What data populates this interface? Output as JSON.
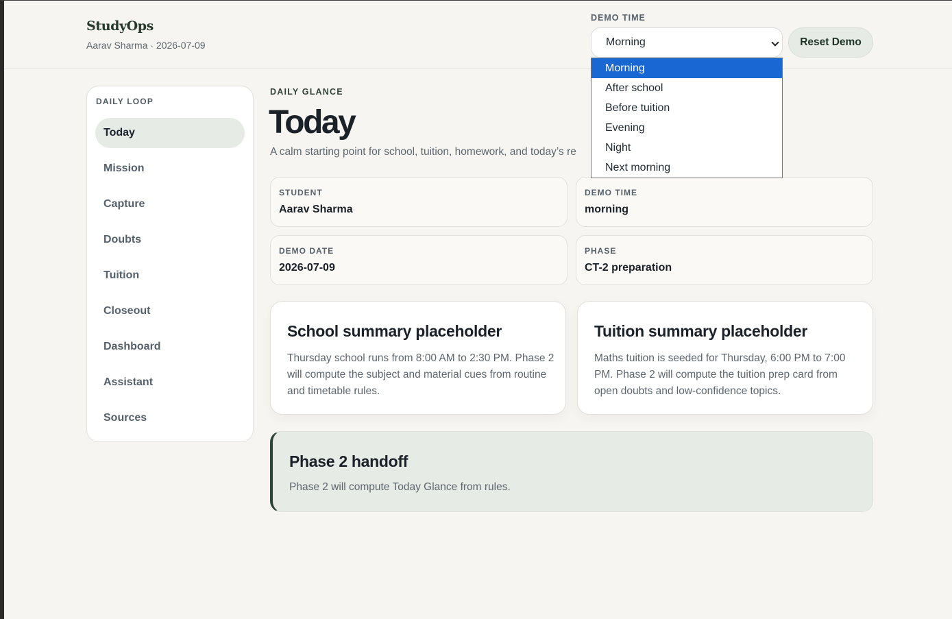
{
  "header": {
    "brand": "StudyOps",
    "subtitle": "Aarav Sharma · 2026-07-09",
    "demo_time_label": "DEMO TIME",
    "selected_time": "Morning",
    "reset_label": "Reset Demo"
  },
  "dropdown": {
    "options": [
      "Morning",
      "After school",
      "Before tuition",
      "Evening",
      "Night",
      "Next morning"
    ],
    "highlighted": "Morning"
  },
  "sidebar": {
    "heading": "DAILY LOOP",
    "items": [
      {
        "label": "Today",
        "active": true
      },
      {
        "label": "Mission"
      },
      {
        "label": "Capture"
      },
      {
        "label": "Doubts"
      },
      {
        "label": "Tuition"
      },
      {
        "label": "Closeout"
      },
      {
        "label": "Dashboard"
      },
      {
        "label": "Assistant"
      },
      {
        "label": "Sources"
      }
    ]
  },
  "main": {
    "eyebrow": "DAILY GLANCE",
    "title": "Today",
    "subtitle": "A calm starting point for school, tuition, homework, and today’s re",
    "info": [
      {
        "label": "STUDENT",
        "value": "Aarav Sharma"
      },
      {
        "label": "DEMO TIME",
        "value": "morning"
      },
      {
        "label": "DEMO DATE",
        "value": "2026-07-09"
      },
      {
        "label": "PHASE",
        "value": "CT-2 preparation"
      }
    ],
    "summaries": [
      {
        "title": "School summary placeholder",
        "body": "Thursday school runs from 8:00 AM to 2:30 PM. Phase 2 will compute the subject and material cues from routine and timetable rules."
      },
      {
        "title": "Tuition summary placeholder",
        "body": "Maths tuition is seeded for Thursday, 6:00 PM to 7:00 PM. Phase 2 will compute the tuition prep card from open doubts and low-confidence topics."
      }
    ],
    "handoff": {
      "title": "Phase 2 handoff",
      "body": "Phase 2 will compute Today Glance from rules."
    }
  },
  "colors": {
    "background": "#f6f5f1",
    "accent_green": "#2e4436",
    "active_nav": "#e6ebe6",
    "dropdown_highlight": "#1967d2"
  }
}
